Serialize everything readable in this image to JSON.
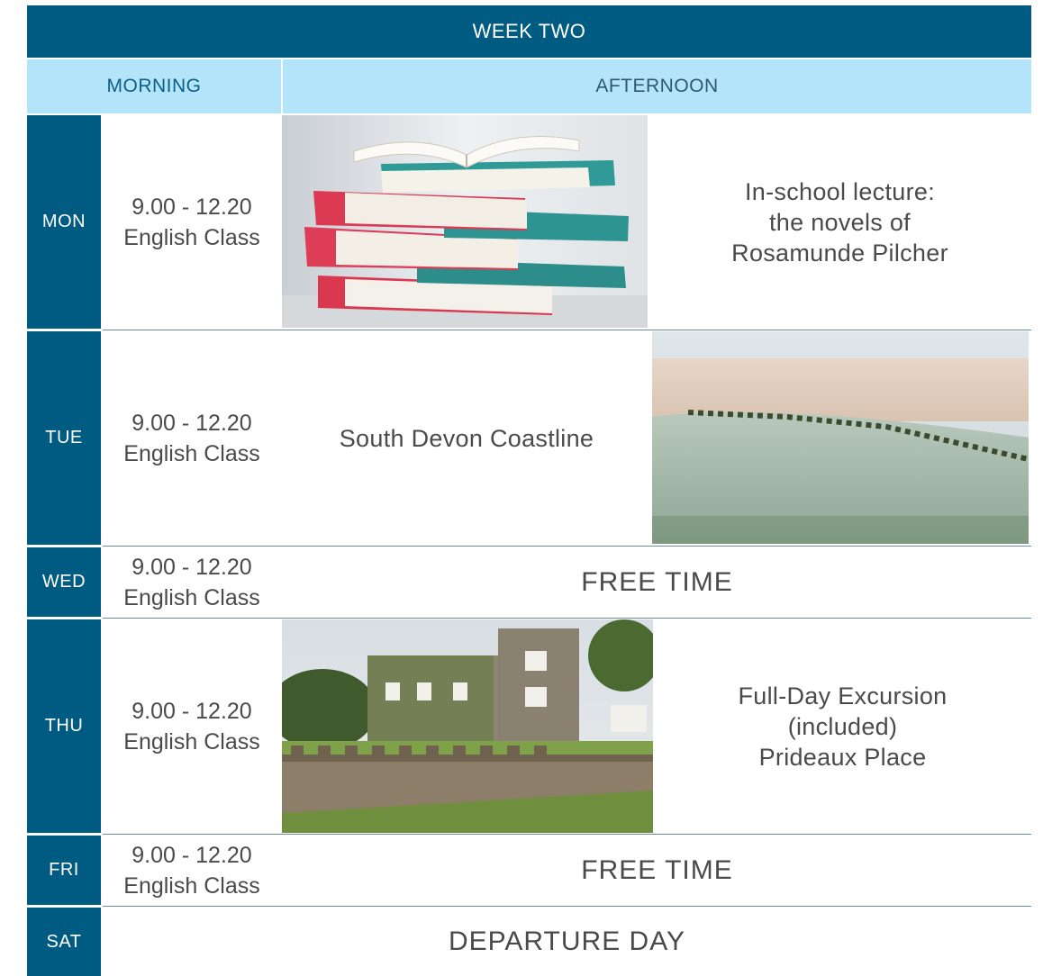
{
  "header": {
    "title": "WEEK TWO"
  },
  "subheader": {
    "morning": "MORNING",
    "afternoon": "AFTERNOON"
  },
  "rows": [
    {
      "day": "MON",
      "morning": [
        "9.00 - 12.20",
        "English Class"
      ],
      "afternoon": [
        "In-school lecture:",
        "the novels of",
        "Rosamunde Pilcher"
      ]
    },
    {
      "day": "TUE",
      "morning": [
        "9.00 - 12.20",
        "English Class"
      ],
      "afternoon": [
        "South Devon Coastline"
      ]
    },
    {
      "day": "WED",
      "morning": [
        "9.00 - 12.20",
        "English Class"
      ],
      "afternoon": [
        "FREE TIME"
      ]
    },
    {
      "day": "THU",
      "morning": [
        "9.00 - 12.20",
        "English Class"
      ],
      "afternoon": [
        "Full-Day Excursion",
        "(included)",
        "Prideaux Place"
      ]
    },
    {
      "day": "FRI",
      "morning": [
        "9.00 - 12.20",
        "English Class"
      ],
      "afternoon": [
        "FREE TIME"
      ]
    },
    {
      "day": "SAT",
      "afternoon": [
        "DEPARTURE DAY"
      ]
    }
  ],
  "colors": {
    "dark_blue": "#005b82",
    "light_blue": "#b4e4f9",
    "text_gray": "#4a4a4a"
  },
  "images": {
    "mon": "stack-of-books-photo",
    "tue": "beach-coastline-photo",
    "thu": "prideaux-place-manor-photo"
  }
}
